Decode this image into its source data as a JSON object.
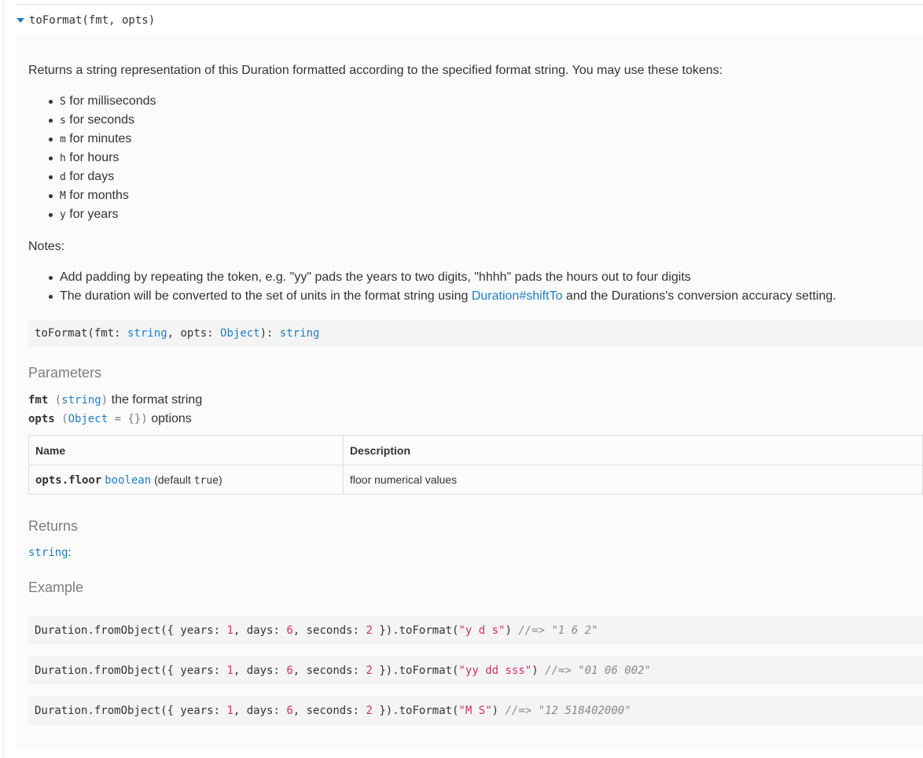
{
  "member": {
    "title": "toFormat(fmt, opts)"
  },
  "description": "Returns a string representation of this Duration formatted according to the specified format string. You may use these tokens:",
  "tokens": [
    {
      "token": "S",
      "text": " for milliseconds"
    },
    {
      "token": "s",
      "text": " for seconds"
    },
    {
      "token": "m",
      "text": " for minutes"
    },
    {
      "token": "h",
      "text": " for hours"
    },
    {
      "token": "d",
      "text": " for days"
    },
    {
      "token": "M",
      "text": " for months"
    },
    {
      "token": "y",
      "text": " for years"
    }
  ],
  "notes": {
    "label": "Notes:",
    "item1": "Add padding by repeating the token, e.g. \"yy\" pads the years to two digits, \"hhhh\" pads the hours out to four digits",
    "item2_before": "The duration will be converted to the set of units in the format string using ",
    "item2_link": "Duration#shiftTo",
    "item2_after": " and the Durations's conversion accuracy setting."
  },
  "signature": {
    "prefix": "toFormat(fmt: ",
    "t1": "string",
    "mid": ", opts: ",
    "t2": "Object",
    "close": "): ",
    "t3": "string"
  },
  "parameters": {
    "heading": "Parameters",
    "items": [
      {
        "name": "fmt",
        "open": " (",
        "type": "string",
        "default": "",
        "close": ")",
        "desc": " the format string"
      },
      {
        "name": "opts",
        "open": " (",
        "type": "Object",
        "default": " = {}",
        "close": ")",
        "desc": " options"
      }
    ],
    "table": {
      "headers": [
        "Name",
        "Description"
      ],
      "rows": [
        {
          "name": "opts.floor",
          "type": "boolean",
          "default_label": " (default ",
          "default_value": "true",
          "default_close": ")",
          "description": "floor numerical values"
        }
      ]
    }
  },
  "returns": {
    "heading": "Returns",
    "type": "string",
    "suffix": ":"
  },
  "example": {
    "heading": "Example",
    "lines": [
      {
        "pre": "Duration.fromObject({ years: ",
        "n1": "1",
        "m1": ", days: ",
        "n2": "6",
        "m2": ", seconds: ",
        "n3": "2",
        "m3": " }).toFormat(",
        "arg": "\"y d s\"",
        "m4": ") ",
        "comment": "//=> \"1 6 2\""
      },
      {
        "pre": "Duration.fromObject({ years: ",
        "n1": "1",
        "m1": ", days: ",
        "n2": "6",
        "m2": ", seconds: ",
        "n3": "2",
        "m3": " }).toFormat(",
        "arg": "\"yy dd sss\"",
        "m4": ") ",
        "comment": "//=> \"01 06 002\""
      },
      {
        "pre": "Duration.fromObject({ years: ",
        "n1": "1",
        "m1": ", days: ",
        "n2": "6",
        "m2": ", seconds: ",
        "n3": "2",
        "m3": " }).toFormat(",
        "arg": "\"M S\"",
        "m4": ") ",
        "comment": "//=> \"12 518402000\""
      }
    ]
  }
}
